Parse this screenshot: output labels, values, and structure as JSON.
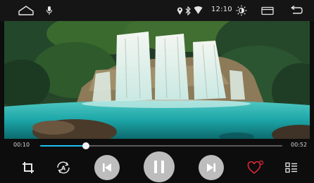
{
  "status_bar": {
    "home_icon": "home-outline-icon",
    "mic_icon": "microphone-icon",
    "location_icon": "location-pin-icon",
    "bluetooth_icon": "bluetooth-icon",
    "wifi_icon": "wifi-icon",
    "time": "12:10",
    "brightness_icon": "brightness-icon",
    "window_icon": "window-icon",
    "back_icon": "back-arrow-icon"
  },
  "player": {
    "elapsed": "00:10",
    "duration": "00:52",
    "progress_fraction": 0.19,
    "accent_color": "#1ec0ef",
    "favorite_color": "#e0263a"
  },
  "controls": {
    "crop_icon": "crop-icon",
    "repeat_icon": "repeat-a-icon",
    "previous_icon": "skip-previous-icon",
    "play_pause_icon": "pause-icon",
    "next_icon": "skip-next-icon",
    "favorite_icon": "heart-outline-icon",
    "playlist_icon": "playlist-icon"
  }
}
